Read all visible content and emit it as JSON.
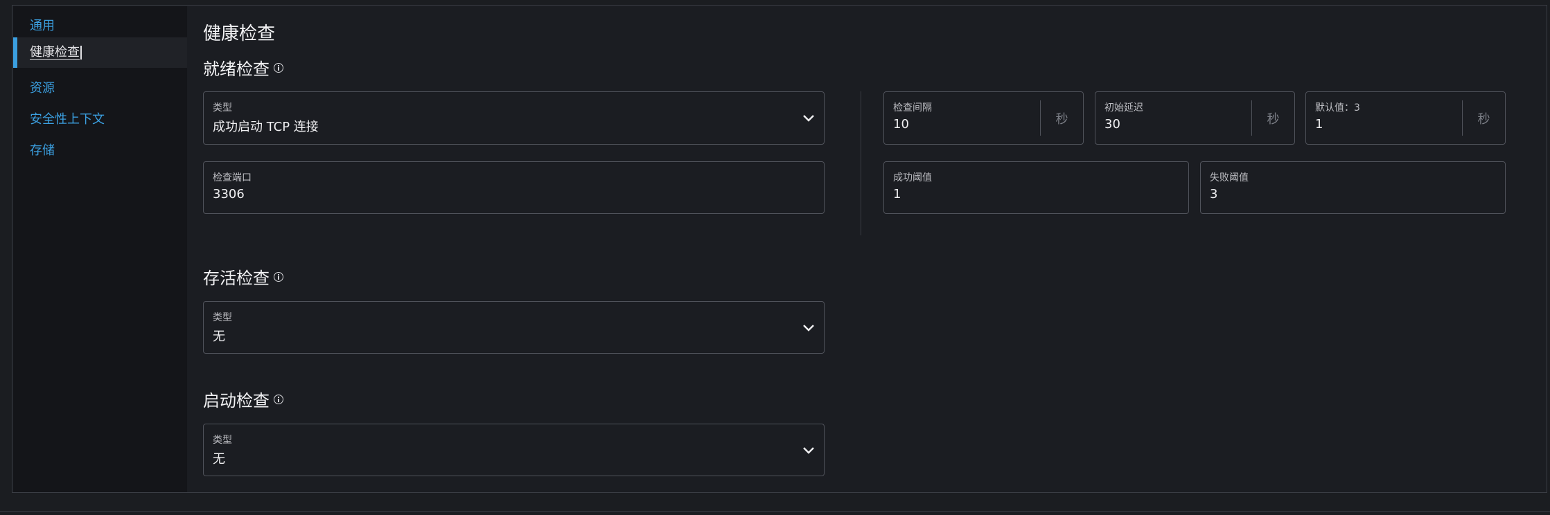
{
  "sidebar": {
    "items": [
      {
        "label": "通用"
      },
      {
        "label": "健康检查",
        "active": true
      },
      {
        "label": "资源"
      },
      {
        "label": "安全性上下文"
      },
      {
        "label": "存储"
      }
    ]
  },
  "page": {
    "title": "健康检查"
  },
  "readiness": {
    "title": "就绪检查",
    "type": {
      "label": "类型",
      "value": "成功启动 TCP 连接"
    },
    "port": {
      "label": "检查端口",
      "value": "3306"
    },
    "interval": {
      "label": "检查间隔",
      "value": "10",
      "unit": "秒"
    },
    "initial_delay": {
      "label": "初始延迟",
      "value": "30",
      "unit": "秒"
    },
    "timeout": {
      "label": "默认值：3",
      "value": "1",
      "unit": "秒"
    },
    "success_threshold": {
      "label": "成功阈值",
      "value": "1"
    },
    "failure_threshold": {
      "label": "失败阈值",
      "value": "3"
    }
  },
  "liveness": {
    "title": "存活检查",
    "type": {
      "label": "类型",
      "value": "无"
    }
  },
  "startup": {
    "title": "启动检查",
    "type": {
      "label": "类型",
      "value": "无"
    }
  },
  "colors": {
    "accent": "#3b9fe0",
    "background": "#1b1d22",
    "sidebar": "#141519",
    "border": "#50535b"
  }
}
